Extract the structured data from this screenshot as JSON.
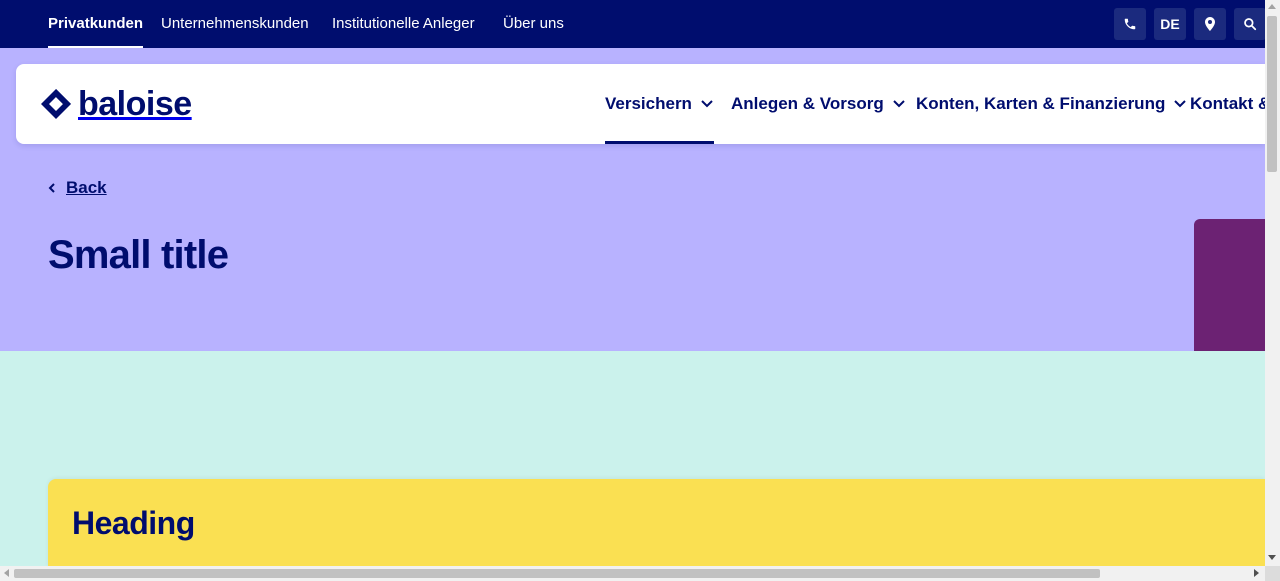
{
  "topnav": {
    "items": [
      {
        "label": "Privatkunden",
        "active": true
      },
      {
        "label": "Unternehmenskunden"
      },
      {
        "label": "Institutionelle Anleger"
      },
      {
        "label": "Über uns"
      }
    ]
  },
  "utility": {
    "phone_icon": "phone-icon",
    "language": "DE",
    "location_icon": "map-pin-icon",
    "search_icon": "search-icon"
  },
  "brand": {
    "name": "baloise",
    "logo_icon": "baloise-diamond-logo-icon",
    "color": "#000d6e"
  },
  "mainnav": {
    "items": [
      {
        "label": "Versichern",
        "active": true
      },
      {
        "label": "Anlegen & Vorsorg"
      },
      {
        "label": "Konten, Karten & Finanzierung"
      },
      {
        "label": "Kontakt &"
      }
    ]
  },
  "hero": {
    "back_label": "Back",
    "title": "Small title",
    "bg_color": "#b8b2ff",
    "accent_color": "#6c2273"
  },
  "card": {
    "heading": "Heading",
    "text": "",
    "bg_color": "#fae052"
  }
}
